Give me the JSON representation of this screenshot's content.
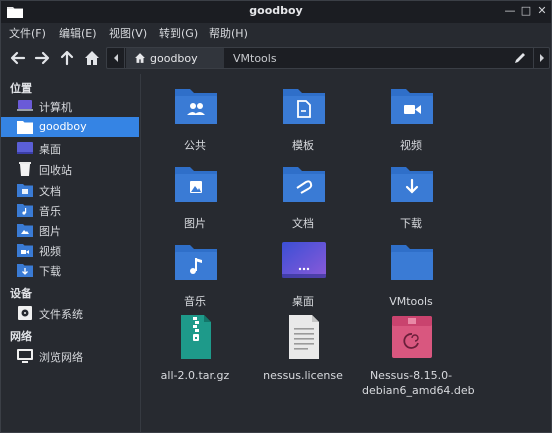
{
  "window": {
    "title": "goodboy"
  },
  "menu": [
    "文件(F)",
    "编辑(E)",
    "视图(V)",
    "转到(G)",
    "帮助(H)"
  ],
  "path": {
    "active": "goodboy",
    "next": "VMtools"
  },
  "sidebar": {
    "places_header": "位置",
    "places": [
      {
        "label": "计算机",
        "icon": "computer-icon"
      },
      {
        "label": "goodboy",
        "icon": "home-folder-icon",
        "active": true
      },
      {
        "label": "桌面",
        "icon": "desktop-icon"
      },
      {
        "label": "回收站",
        "icon": "trash-icon"
      },
      {
        "label": "文档",
        "icon": "documents-folder-icon"
      },
      {
        "label": "音乐",
        "icon": "music-folder-icon"
      },
      {
        "label": "图片",
        "icon": "pictures-folder-icon"
      },
      {
        "label": "视频",
        "icon": "videos-folder-icon"
      },
      {
        "label": "下载",
        "icon": "downloads-folder-icon"
      }
    ],
    "devices_header": "设备",
    "devices": [
      {
        "label": "文件系统",
        "icon": "filesystem-icon"
      }
    ],
    "network_header": "网络",
    "network": [
      {
        "label": "浏览网络",
        "icon": "network-icon"
      }
    ]
  },
  "files": [
    {
      "name": "公共",
      "icon": "public-folder-icon"
    },
    {
      "name": "模板",
      "icon": "templates-folder-icon"
    },
    {
      "name": "视频",
      "icon": "videos-folder-icon"
    },
    {
      "name": "图片",
      "icon": "pictures-folder-icon"
    },
    {
      "name": "文档",
      "icon": "documents-folder-icon"
    },
    {
      "name": "下载",
      "icon": "downloads-folder-icon"
    },
    {
      "name": "音乐",
      "icon": "music-folder-icon"
    },
    {
      "name": "桌面",
      "icon": "desktop-folder-icon"
    },
    {
      "name": "VMtools",
      "icon": "folder-icon"
    },
    {
      "name": "all-2.0.tar.gz",
      "icon": "archive-icon"
    },
    {
      "name": "nessus.license",
      "icon": "text-file-icon"
    },
    {
      "name": "Nessus-8.15.0-debian6_amd64.deb",
      "icon": "deb-package-icon"
    }
  ],
  "colors": {
    "accent": "#3584e4",
    "folder": "#3a7bd5",
    "background": "#272a30"
  }
}
